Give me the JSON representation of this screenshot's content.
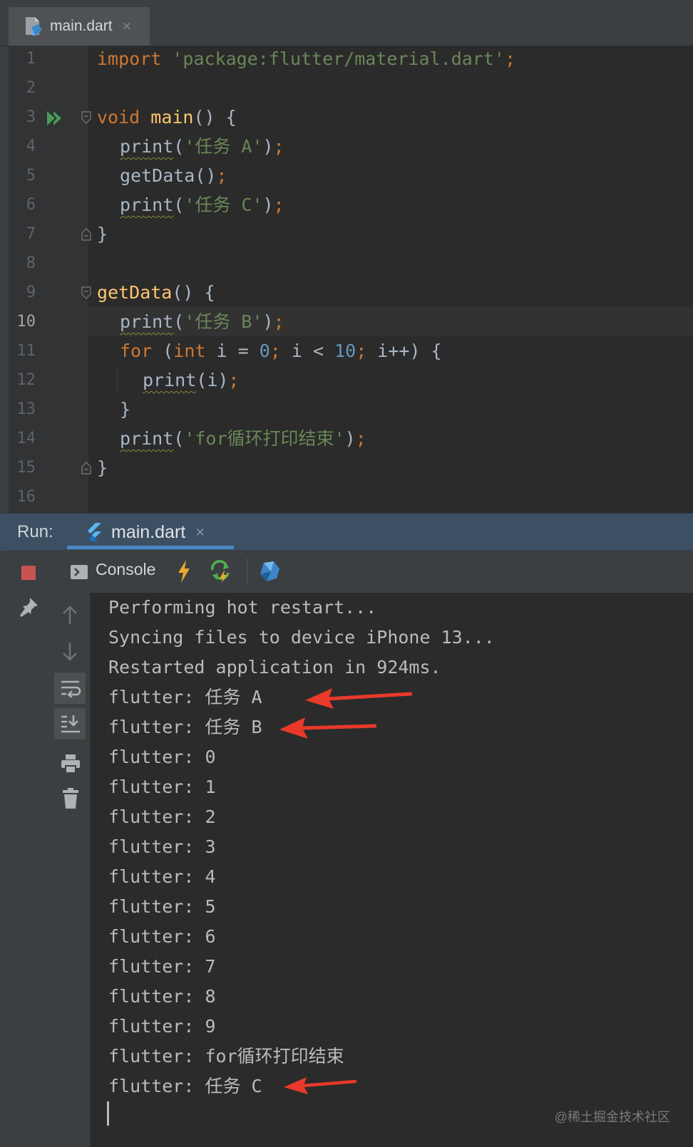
{
  "editor": {
    "tab": {
      "label": "main.dart",
      "close": "×"
    },
    "lines": [
      {
        "num": "1"
      },
      {
        "num": "2"
      },
      {
        "num": "3"
      },
      {
        "num": "4"
      },
      {
        "num": "5"
      },
      {
        "num": "6"
      },
      {
        "num": "7"
      },
      {
        "num": "8"
      },
      {
        "num": "9"
      },
      {
        "num": "10"
      },
      {
        "num": "11"
      },
      {
        "num": "12"
      },
      {
        "num": "13"
      },
      {
        "num": "14"
      },
      {
        "num": "15"
      },
      {
        "num": "16"
      }
    ],
    "current_line": "10",
    "code": {
      "l1_kw": "import",
      "l1_str": "'package:flutter/material.dart'",
      "l3_kw": "void",
      "l3_fn": "main",
      "l3_rest": "() {",
      "print": "print",
      "l4_str": "'任务 A'",
      "l5_call": "getData()",
      "l6_str": "'任务 C'",
      "brace_close": "}",
      "l9_fn": "getData",
      "l9_rest": "() {",
      "l10_str": "'任务 B'",
      "l11_for": "for",
      "l11_open": " (",
      "l11_int": "int",
      "l11_i": " i = ",
      "l11_zero": "0",
      "l11_cond": " i < ",
      "l11_ten": "10",
      "l11_inc": " i++) {",
      "l12_arg": "(i)",
      "l14_str": "'for循环打印结束'"
    }
  },
  "run_panel": {
    "label": "Run:",
    "tab_label": "main.dart",
    "tab_close": "×",
    "console_label": "Console",
    "output": [
      "Performing hot restart...",
      "Syncing files to device iPhone 13...",
      "Restarted application in 924ms.",
      "flutter: 任务 A",
      "flutter: 任务 B",
      "flutter: 0",
      "flutter: 1",
      "flutter: 2",
      "flutter: 3",
      "flutter: 4",
      "flutter: 5",
      "flutter: 6",
      "flutter: 7",
      "flutter: 8",
      "flutter: 9",
      "flutter: for循环打印结束",
      "flutter: 任务 C"
    ]
  },
  "watermark": "@稀土掘金技术社区",
  "colors": {
    "keyword": "#cc7832",
    "string": "#6a8759",
    "number": "#6897bb",
    "function": "#ffc66d",
    "text": "#a9b7c6",
    "arrow": "#e8392b",
    "stop": "#c75450",
    "run_tab_underline": "#4a88c7"
  },
  "icons": [
    "dart-file-icon",
    "run-gutter-icon",
    "fold-icon",
    "flutter-icon",
    "stop-icon",
    "pin-icon",
    "console-icon",
    "hot-reload-icon",
    "hot-restart-icon",
    "dart-devtools-icon",
    "scroll-up-icon",
    "scroll-down-icon",
    "soft-wrap-icon",
    "scroll-to-end-icon",
    "print-icon",
    "clear-icon",
    "arrow-annotation"
  ]
}
